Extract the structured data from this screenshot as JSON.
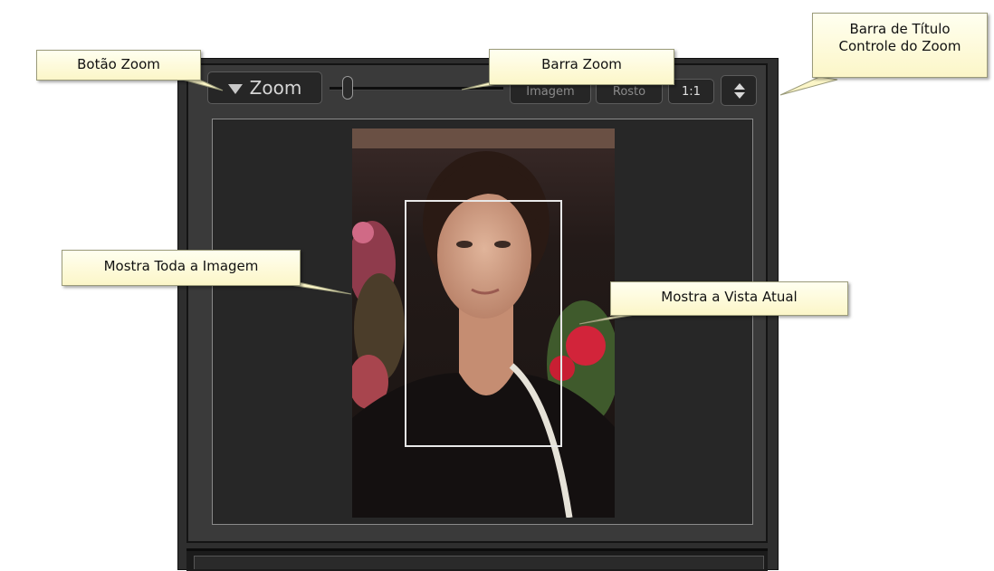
{
  "toolbar": {
    "zoom_label": "Zoom",
    "image_label": "Imagem",
    "face_label": "Rosto",
    "one_to_one_label": "1:1"
  },
  "callouts": {
    "zoom_button": "Botão Zoom",
    "zoom_bar": "Barra Zoom",
    "title_bar_line1": "Barra de Título",
    "title_bar_line2": "Controle do Zoom",
    "show_whole_image": "Mostra Toda a Imagem",
    "show_current_view": "Mostra a Vista Atual"
  },
  "icons": {
    "zoom_toggle": "triangle-down-icon",
    "sort": "up-down-arrows-icon"
  },
  "colors": {
    "panel": "#2e2e2e",
    "viewer_bg": "#272727",
    "callout_bg": "#fcf6c8",
    "view_rect": "#e8e8e8"
  }
}
